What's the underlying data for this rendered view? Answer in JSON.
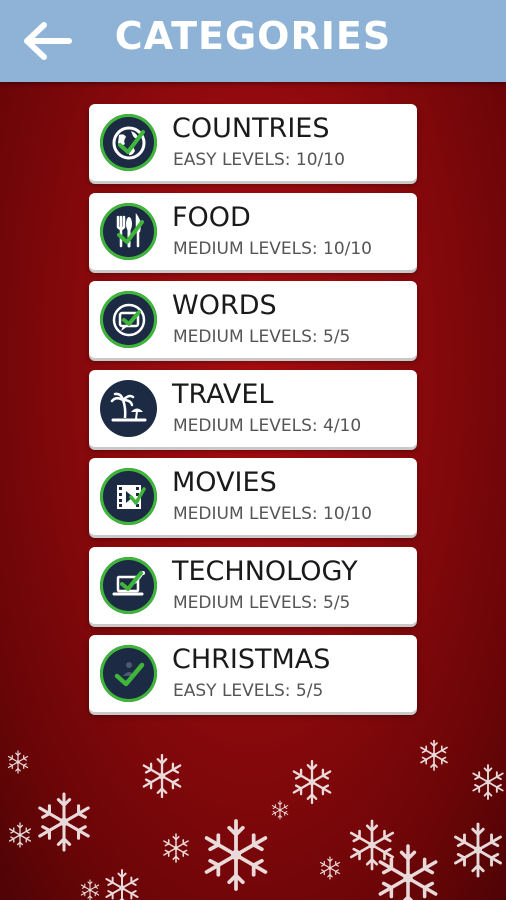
{
  "header": {
    "title": "CATEGORIES",
    "back_icon": "arrow-left-icon",
    "background": "#8fb3d6"
  },
  "categories": [
    {
      "name": "COUNTRIES",
      "levels": "EASY LEVELS: 10/10",
      "icon": "globe-icon",
      "completed": true
    },
    {
      "name": "FOOD",
      "levels": "MEDIUM LEVELS: 10/10",
      "icon": "fork-knife-icon",
      "completed": true
    },
    {
      "name": "WORDS",
      "levels": "MEDIUM LEVELS: 5/5",
      "icon": "chat-bubble-icon",
      "completed": true
    },
    {
      "name": "TRAVEL",
      "levels": "MEDIUM LEVELS: 4/10",
      "icon": "palm-tree-icon",
      "completed": false
    },
    {
      "name": "MOVIES",
      "levels": "MEDIUM LEVELS: 10/10",
      "icon": "film-play-icon",
      "completed": true
    },
    {
      "name": "TECHNOLOGY",
      "levels": "MEDIUM LEVELS: 5/5",
      "icon": "laptop-icon",
      "completed": true
    },
    {
      "name": "CHRISTMAS",
      "levels": "EASY LEVELS: 5/5",
      "icon": "christmas-icon",
      "completed": true
    }
  ],
  "colors": {
    "background_red": "#8f0a0d",
    "card": "#ffffff",
    "icon_circle": "#1c2b43",
    "check_green": "#3fb53a"
  }
}
